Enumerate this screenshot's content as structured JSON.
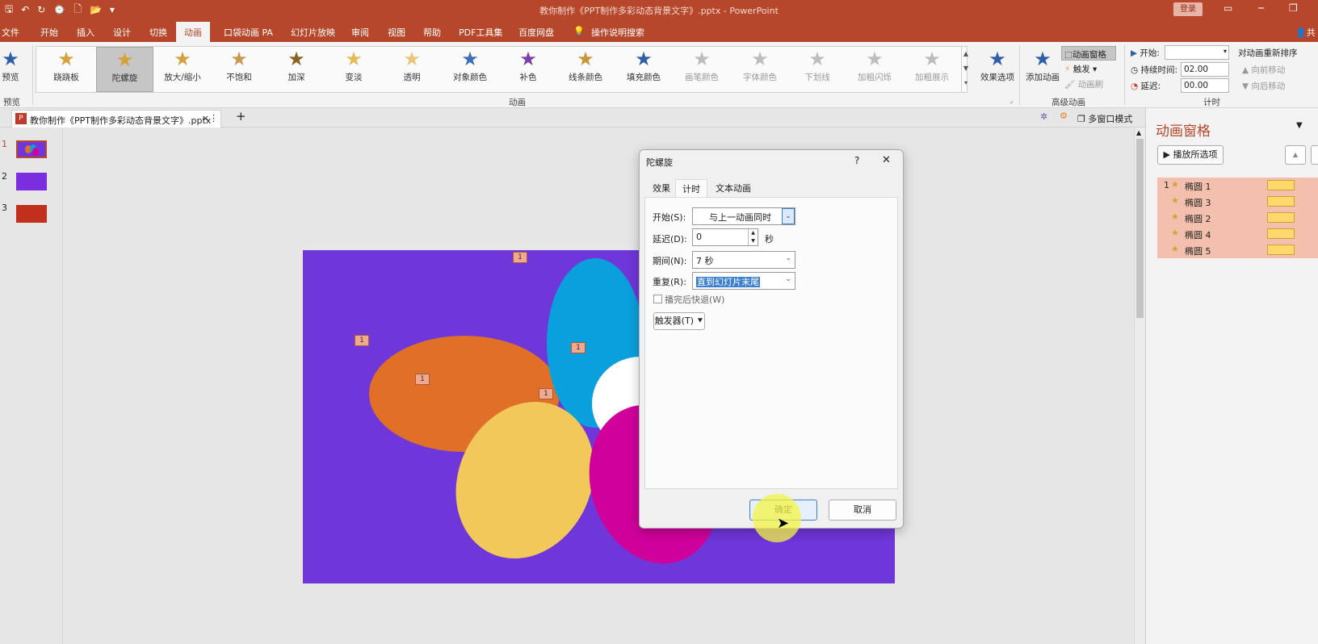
{
  "window": {
    "title": "教你制作《PPT制作多彩动态背景文字》.pptx - PowerPoint",
    "login": "登录"
  },
  "quick_access": {
    "save": "🖫",
    "undo": "↶",
    "redo": "↻",
    "touch": "⌚",
    "new": "🗋",
    "open": "📂",
    "more": "▾"
  },
  "menu_tabs": [
    {
      "label": "文件"
    },
    {
      "label": "开始"
    },
    {
      "label": "插入"
    },
    {
      "label": "设计"
    },
    {
      "label": "切换"
    },
    {
      "label": "动画"
    },
    {
      "label": "口袋动画 PA"
    },
    {
      "label": "幻灯片放映"
    },
    {
      "label": "审阅"
    },
    {
      "label": "视图"
    },
    {
      "label": "帮助"
    },
    {
      "label": "PDF工具集"
    },
    {
      "label": "百度网盘"
    },
    {
      "label": "操作说明搜索"
    }
  ],
  "share_label": "共",
  "ribbon": {
    "preview_label": "预览",
    "preview_group": "预览",
    "effects": [
      {
        "label": "跷跷板"
      },
      {
        "label": "陀螺旋"
      },
      {
        "label": "放大/缩小"
      },
      {
        "label": "不饱和"
      },
      {
        "label": "加深"
      },
      {
        "label": "变淡"
      },
      {
        "label": "透明"
      },
      {
        "label": "对象颜色"
      },
      {
        "label": "补色"
      },
      {
        "label": "线条颜色"
      },
      {
        "label": "填充颜色"
      },
      {
        "label": "画笔颜色"
      },
      {
        "label": "字体颜色"
      },
      {
        "label": "下划线"
      },
      {
        "label": "加粗闪烁"
      },
      {
        "label": "加粗展示"
      }
    ],
    "effect_options": "效果选项",
    "animation_group": "动画",
    "add_animation": "添加动画",
    "animation_pane": "动画窗格",
    "trigger": "触发",
    "painter": "动画刷",
    "advanced_group": "高级动画",
    "start_label": "开始:",
    "start_value": "",
    "duration_label": "持续时间:",
    "duration_value": "02.00",
    "delay_label": "延迟:",
    "delay_value": "00.00",
    "timing_group": "计时",
    "reorder": "对动画重新排序",
    "move_earlier": "向前移动",
    "move_later": "向后移动"
  },
  "doc_tab": {
    "label": "教你制作《PPT制作多彩动态背景文字》.pptx",
    "close": "×",
    "more": "⋮",
    "add": "+"
  },
  "multi_window": "多窗口模式",
  "slides": [
    {
      "num": "1"
    },
    {
      "num": "2"
    },
    {
      "num": "3"
    }
  ],
  "slide_tags": [
    "1",
    "1",
    "1",
    "1",
    "1"
  ],
  "animation_pane": {
    "title": "动画窗格",
    "play_label": "播放所选项",
    "items": [
      {
        "num": "1",
        "name": "椭圆 1"
      },
      {
        "num": "",
        "name": "椭圆 3"
      },
      {
        "num": "",
        "name": "椭圆 2"
      },
      {
        "num": "",
        "name": "椭圆 4"
      },
      {
        "num": "",
        "name": "椭圆 5"
      }
    ]
  },
  "dialog": {
    "title": "陀螺旋",
    "help": "?",
    "close": "✕",
    "tabs": [
      {
        "label": "效果"
      },
      {
        "label": "计时"
      },
      {
        "label": "文本动画"
      }
    ],
    "start_label": "开始(S):",
    "start_value": "与上一动画同时",
    "delay_label": "延迟(D):",
    "delay_value": "0",
    "delay_unit": "秒",
    "duration_label": "期间(N):",
    "duration_value": "7 秒",
    "repeat_label": "重复(R):",
    "repeat_value": "直到幻灯片末尾",
    "rewind_label": "播完后快退(W)",
    "trigger_label": "触发器(T)",
    "ok": "确定",
    "cancel": "取消"
  },
  "colors": {
    "accent": "#b7472a",
    "slide_bg": "#6f36d9"
  }
}
